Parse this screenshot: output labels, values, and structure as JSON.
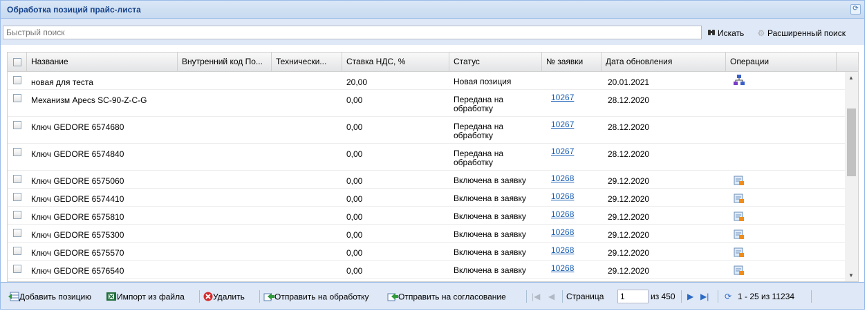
{
  "panel": {
    "title": "Обработка позиций прайс-листа"
  },
  "search": {
    "placeholder": "Быстрый поиск",
    "search_label": "Искать",
    "advanced_label": "Расширенный поиск"
  },
  "columns": [
    "Название",
    "Внутренний код По...",
    "Технически...",
    "Ставка НДС, %",
    "Статус",
    "№ заявки",
    "Дата обновления",
    "Операции"
  ],
  "rows": [
    {
      "name": "новая для теста",
      "vat": "20,00",
      "status": "Новая позиция",
      "order": "",
      "date": "20.01.2021",
      "op": "hierarchy-icon"
    },
    {
      "name": "Механизм Apecs SC-90-Z-C-G",
      "vat": "0,00",
      "status": "Передана на обработку",
      "order": "10267",
      "date": "28.12.2020",
      "op": ""
    },
    {
      "name": "Ключ GEDORE 6574680",
      "vat": "0,00",
      "status": "Передана на обработку",
      "order": "10267",
      "date": "28.12.2020",
      "op": ""
    },
    {
      "name": "Ключ GEDORE 6574840",
      "vat": "0,00",
      "status": "Передана на обработку",
      "order": "10267",
      "date": "28.12.2020",
      "op": ""
    },
    {
      "name": "Ключ GEDORE 6575060",
      "vat": "0,00",
      "status": "Включена в заявку",
      "order": "10268",
      "date": "29.12.2020",
      "op": "form-icon"
    },
    {
      "name": "Ключ GEDORE 6574410",
      "vat": "0,00",
      "status": "Включена в заявку",
      "order": "10268",
      "date": "29.12.2020",
      "op": "form-icon"
    },
    {
      "name": "Ключ GEDORE 6575810",
      "vat": "0,00",
      "status": "Включена в заявку",
      "order": "10268",
      "date": "29.12.2020",
      "op": "form-icon"
    },
    {
      "name": "Ключ GEDORE 6575300",
      "vat": "0,00",
      "status": "Включена в заявку",
      "order": "10268",
      "date": "29.12.2020",
      "op": "form-icon"
    },
    {
      "name": "Ключ GEDORE 6575570",
      "vat": "0,00",
      "status": "Включена в заявку",
      "order": "10268",
      "date": "29.12.2020",
      "op": "form-icon"
    },
    {
      "name": "Ключ GEDORE 6576540",
      "vat": "0,00",
      "status": "Включена в заявку",
      "order": "10268",
      "date": "29.12.2020",
      "op": "form-icon"
    }
  ],
  "footer": {
    "add_label": "Добавить позицию",
    "import_label": "Импорт из файла",
    "delete_label": "Удалить",
    "send_processing_label": "Отправить на обработку",
    "send_approval_label": "Отправить на согласование",
    "page_label": "Страница",
    "page_value": "1",
    "page_of": "из 450",
    "range": "1 - 25 из 11234"
  },
  "colors": {
    "panel_border": "#99bbe8",
    "title_text": "#15428b",
    "toolbar_bg": "#dfe8f6",
    "link": "#1a5fb4"
  }
}
